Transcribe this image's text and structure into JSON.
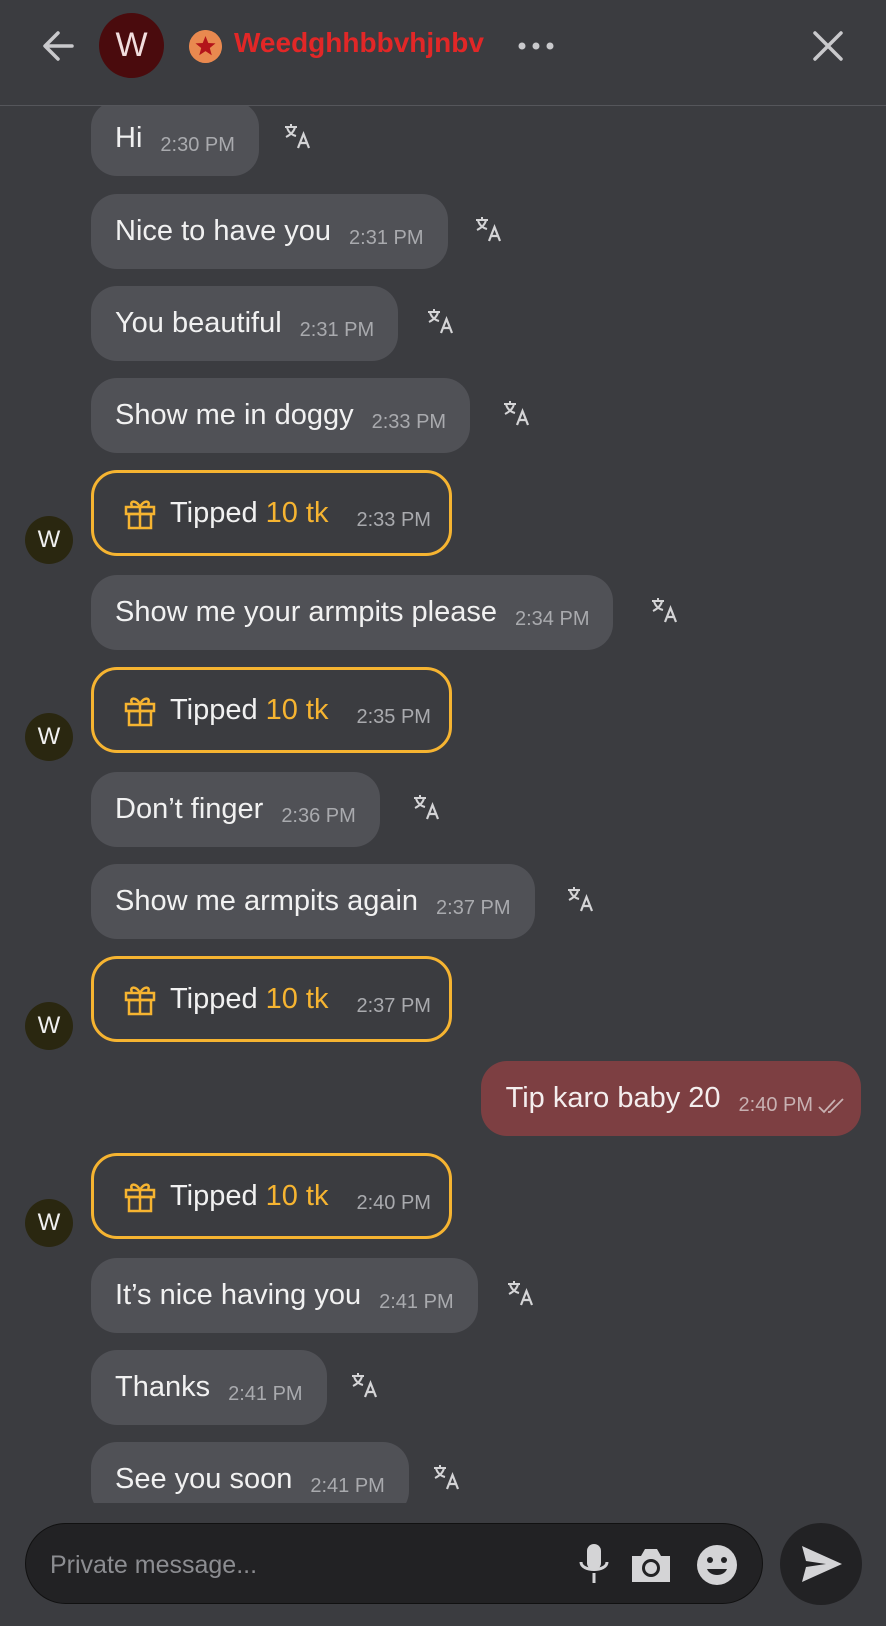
{
  "header": {
    "avatar_letter": "W",
    "username": "Weedghhbbvhjnbv",
    "username_color": "#e22727"
  },
  "messages": [
    {
      "type": "incoming",
      "text": "Hi",
      "time": "2:30 PM"
    },
    {
      "type": "incoming",
      "text": "Nice to have you",
      "time": "2:31 PM"
    },
    {
      "type": "incoming",
      "text": "You beautiful",
      "time": "2:31 PM"
    },
    {
      "type": "incoming",
      "text": "Show me in doggy",
      "time": "2:33 PM"
    },
    {
      "type": "tip",
      "label": "Tipped",
      "amount": "10 tk",
      "time": "2:33 PM",
      "avatar": "W"
    },
    {
      "type": "incoming",
      "text": "Show me your armpits please",
      "time": "2:34 PM"
    },
    {
      "type": "tip",
      "label": "Tipped",
      "amount": "10 tk",
      "time": "2:35 PM",
      "avatar": "W"
    },
    {
      "type": "incoming",
      "text": "Don’t finger",
      "time": "2:36 PM"
    },
    {
      "type": "incoming",
      "text": "Show me armpits again",
      "time": "2:37 PM"
    },
    {
      "type": "tip",
      "label": "Tipped",
      "amount": "10 tk",
      "time": "2:37 PM",
      "avatar": "W"
    },
    {
      "type": "outgoing",
      "text": "Tip karo baby 20",
      "time": "2:40 PM"
    },
    {
      "type": "tip",
      "label": "Tipped",
      "amount": "10 tk",
      "time": "2:40 PM",
      "avatar": "W"
    },
    {
      "type": "incoming",
      "text": "It’s nice having you",
      "time": "2:41 PM"
    },
    {
      "type": "incoming",
      "text": "Thanks",
      "time": "2:41 PM"
    },
    {
      "type": "incoming",
      "text": "See you soon",
      "time": "2:41 PM"
    }
  ],
  "composer": {
    "placeholder": "Private message..."
  },
  "colors": {
    "background": "#3b3c40",
    "incoming_bubble": "#505156",
    "outgoing_bubble": "#7d3f42",
    "tip_accent": "#f6b431"
  }
}
